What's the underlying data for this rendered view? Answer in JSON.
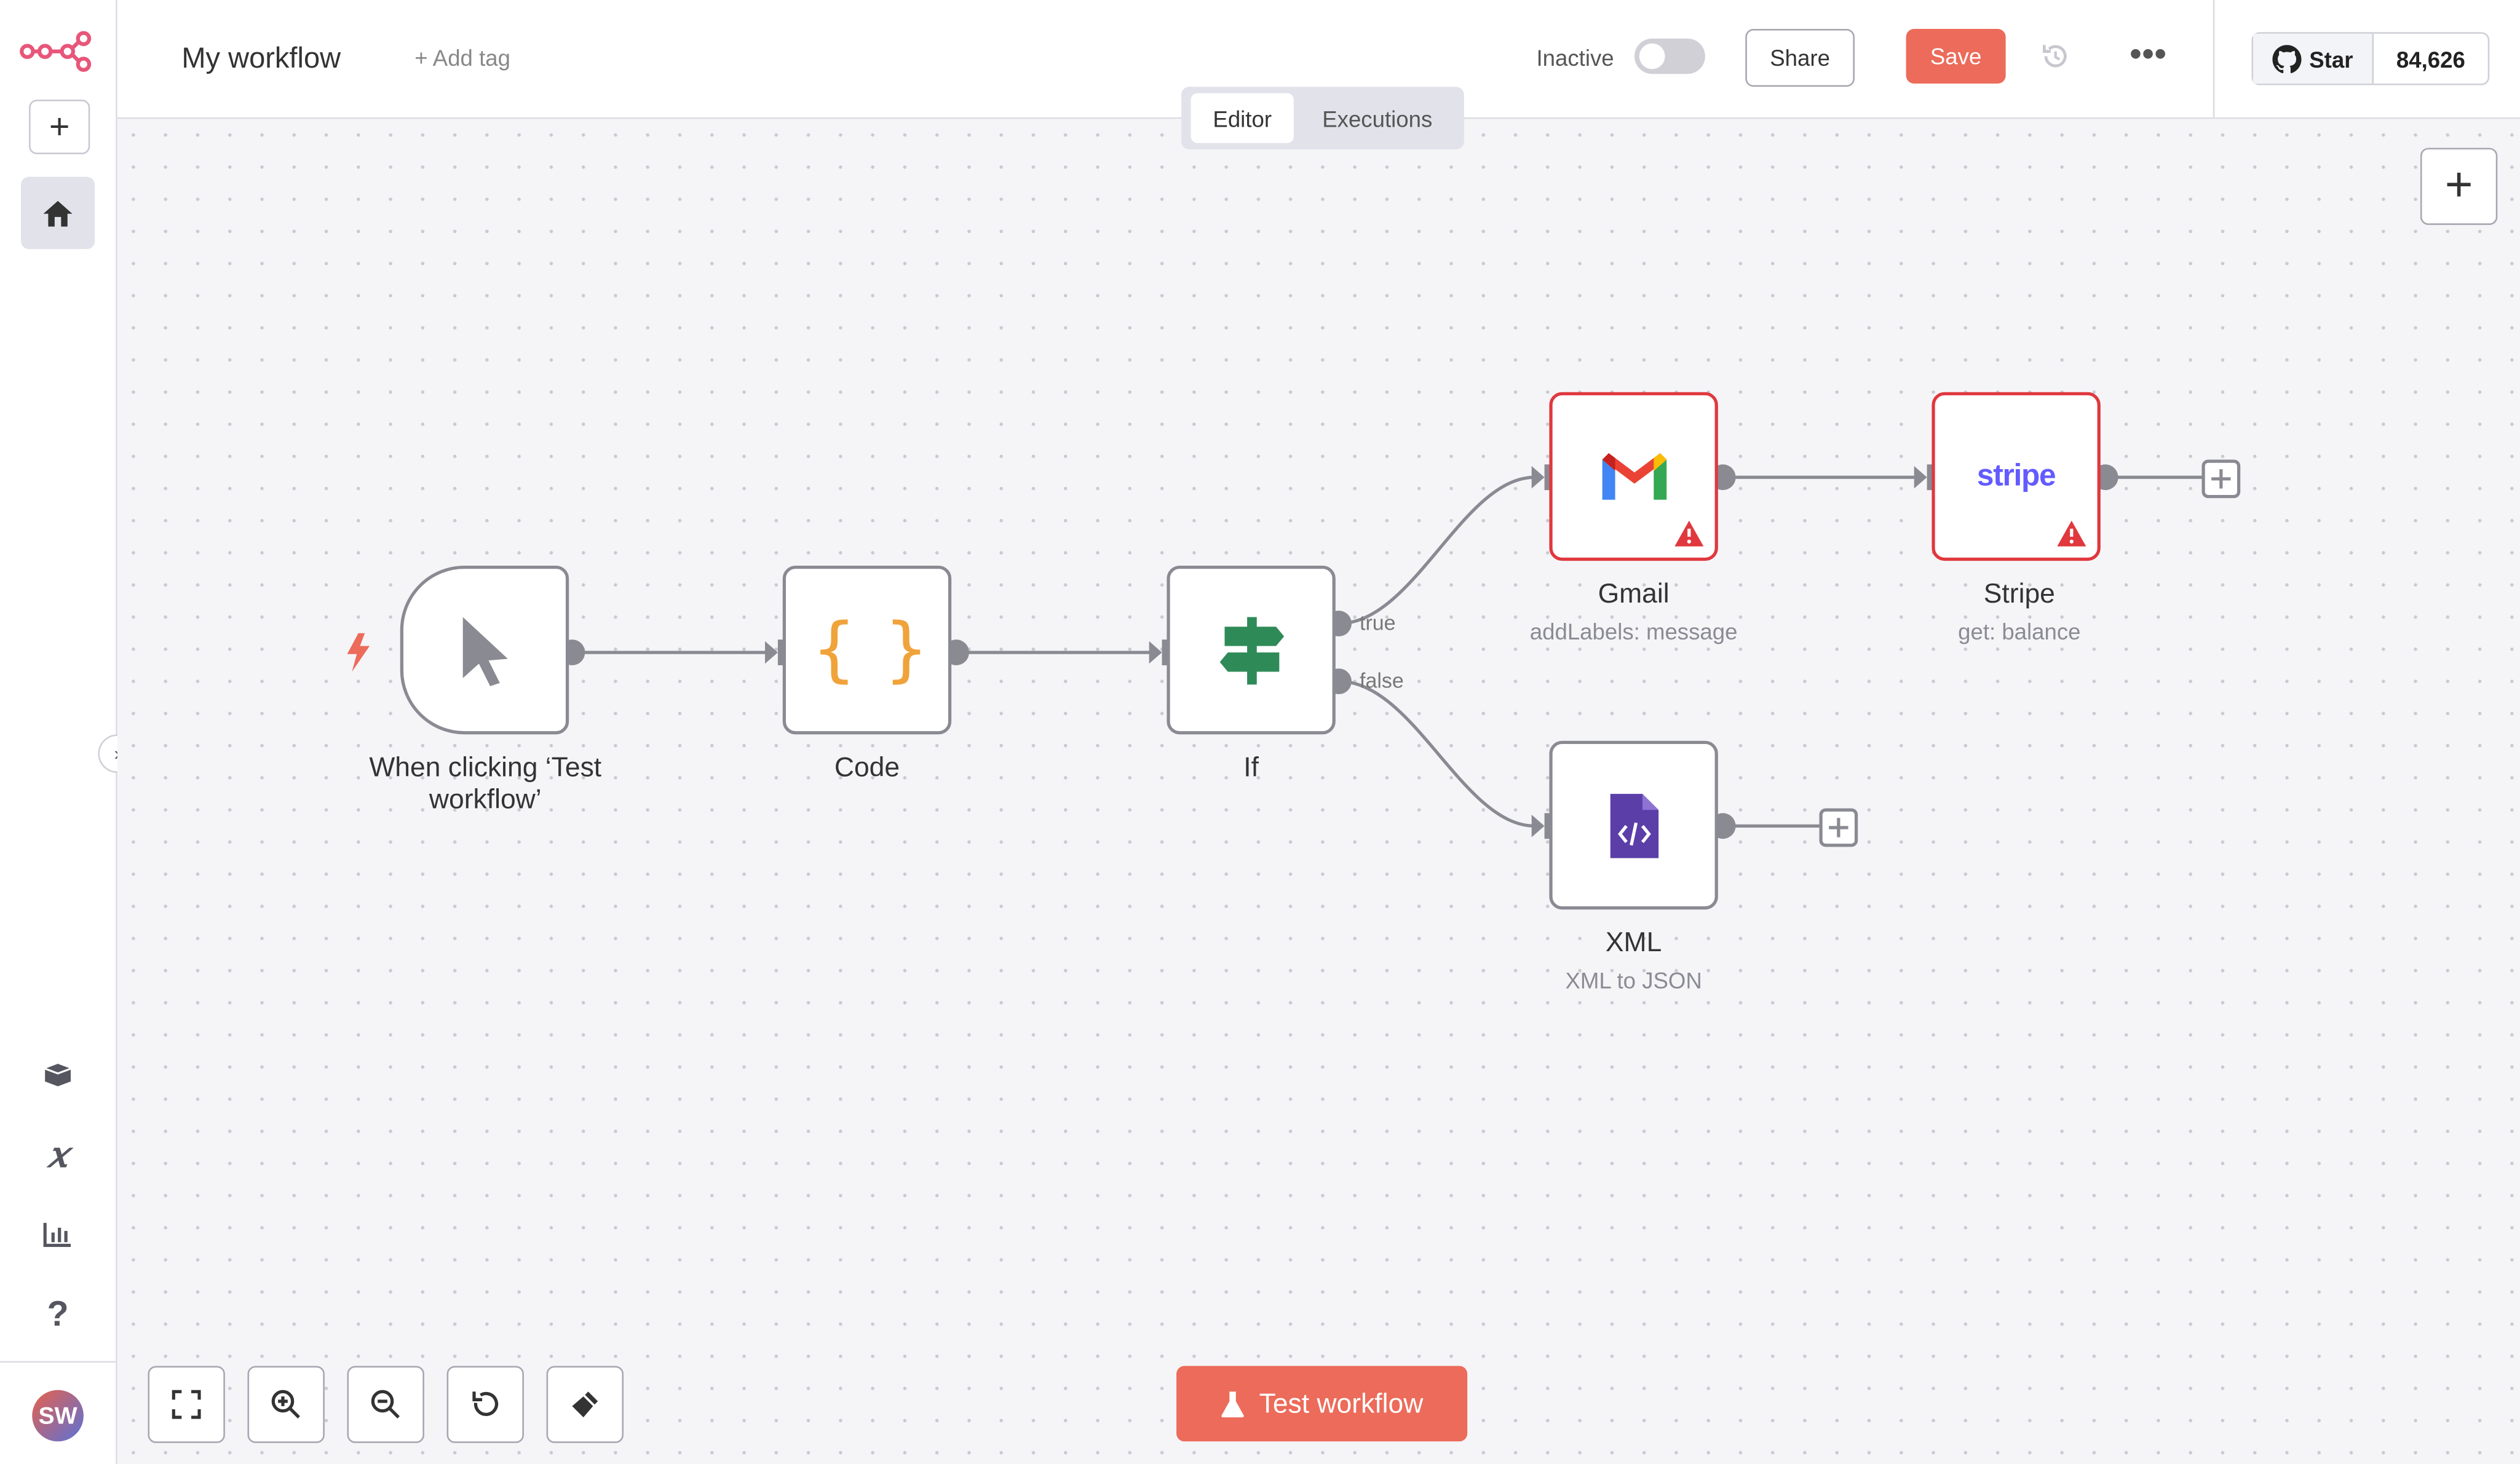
{
  "header": {
    "workflow_name": "My workflow",
    "add_tag": "+ Add tag",
    "active_label": "Inactive",
    "share_label": "Share",
    "save_label": "Save",
    "github_star_label": "Star",
    "github_star_count": "84,626"
  },
  "tabs": {
    "editor": "Editor",
    "executions": "Executions"
  },
  "nodes": {
    "trigger": {
      "title": "When clicking ‘Test workflow’"
    },
    "code": {
      "title": "Code",
      "icon_text": "{ }"
    },
    "if": {
      "title": "If",
      "true_label": "true",
      "false_label": "false"
    },
    "gmail": {
      "title": "Gmail",
      "subtitle": "addLabels: message"
    },
    "stripe": {
      "title": "Stripe",
      "subtitle": "get: balance",
      "logo_text": "stripe"
    },
    "xml": {
      "title": "XML",
      "subtitle": "XML to JSON"
    }
  },
  "sidebar": {
    "avatar_initials": "SW"
  },
  "footer": {
    "test_workflow_label": "Test workflow"
  },
  "colors": {
    "accent": "#ec6b5a",
    "node_border": "#8a8a93",
    "error": "#e0383e",
    "stripe": "#635bff",
    "xml": "#5b3ea8",
    "if_green": "#2e8b57",
    "code_orange": "#f0a33a"
  }
}
